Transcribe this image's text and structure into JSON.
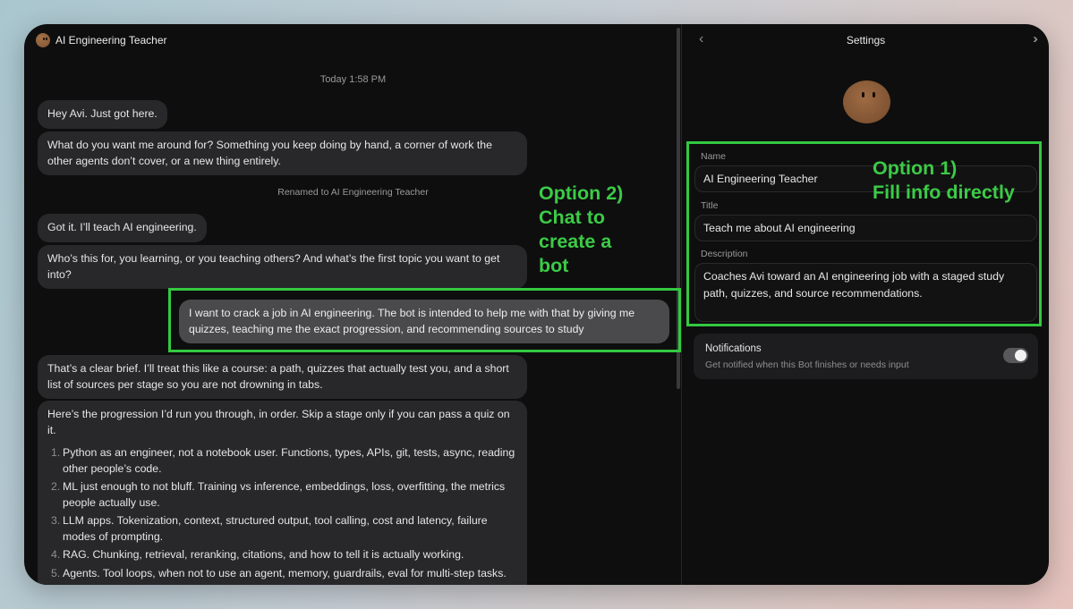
{
  "chat": {
    "title": "AI Engineering Teacher",
    "timestamp": "Today 1:58 PM",
    "messages": [
      {
        "text": "Hey Avi. Just got here."
      },
      {
        "text": "What do you want me around for? Something you keep doing by hand, a corner of work the other agents don’t cover, or a new thing entirely."
      },
      {
        "text": "Got it. I’ll teach AI engineering."
      },
      {
        "text": "Who’s this for, you learning, or you teaching others? And what’s the first topic you want to get into?"
      },
      {
        "text": "I want to crack a job in AI engineering. The bot is intended to help me with that by giving me quizzes, teaching me the exact progression, and recommending sources to study"
      },
      {
        "text": "That’s a clear brief. I’ll treat this like a course: a path, quizzes that actually test you, and a short list of sources per stage so you are not drowning in tabs."
      },
      {
        "text": "Here’s the progression I’d run you through, in order. Skip a stage only if you can pass a quiz on it."
      }
    ],
    "system_note": "Renamed to AI Engineering Teacher",
    "progression": [
      {
        "num": "1.",
        "text": "Python as an engineer, not a notebook user. Functions, types, APIs, git, tests, async, reading other people’s code."
      },
      {
        "num": "2.",
        "text": "ML just enough to not bluff. Training vs inference, embeddings, loss, overfitting, the metrics people actually use."
      },
      {
        "num": "3.",
        "text": "LLM apps. Tokenization, context, structured output, tool calling, cost and latency, failure modes of prompting."
      },
      {
        "num": "4.",
        "text": "RAG. Chunking, retrieval, reranking, citations, and how to tell it is actually working."
      },
      {
        "num": "5.",
        "text": "Agents. Tool loops, when not to use an agent, memory, guardrails, eval for multi-step tasks."
      }
    ]
  },
  "annotations": {
    "option1": "Option 1)\nFill info directly",
    "option2": "Option 2)\nChat to\ncreate a\nbot",
    "color": "#33c940"
  },
  "settings": {
    "title": "Settings",
    "back_icon": "chevron-left-icon",
    "collapse_icon": "double-chevron-right-icon",
    "name_label": "Name",
    "name_value": "AI Engineering Teacher",
    "title_label": "Title",
    "title_value": "Teach me about AI engineering",
    "description_label": "Description",
    "description_value": "Coaches Avi toward an AI engineering job with a staged study path, quizzes, and source recommendations.",
    "notifications": {
      "label": "Notifications",
      "description": "Get notified when this Bot finishes or needs input",
      "enabled": true
    }
  }
}
